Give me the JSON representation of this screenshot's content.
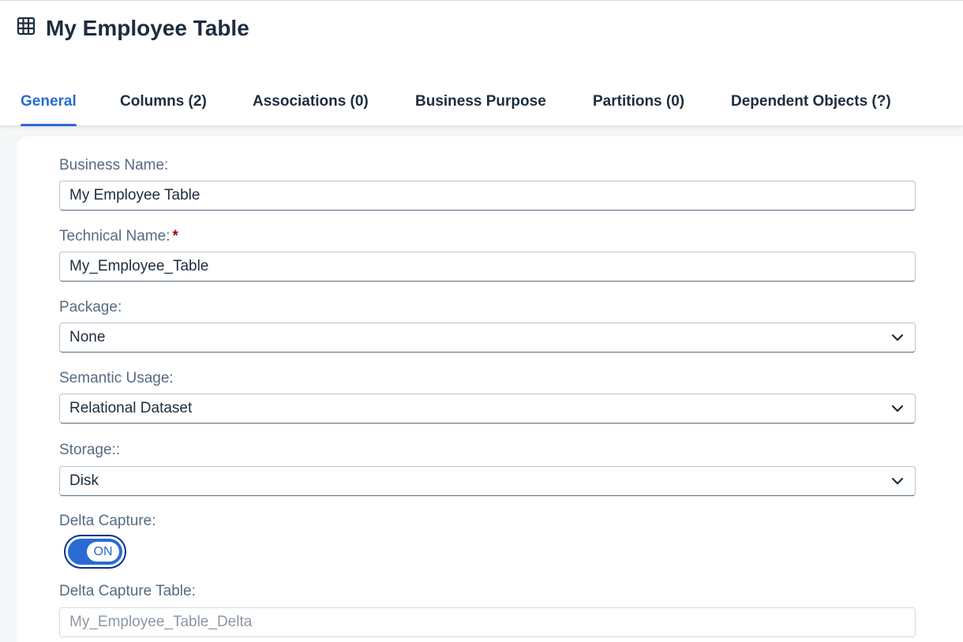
{
  "header": {
    "title": "My Employee Table",
    "icon": "table-grid-icon"
  },
  "tabs": [
    {
      "label": "General",
      "active": true
    },
    {
      "label": "Columns (2)",
      "active": false
    },
    {
      "label": "Associations (0)",
      "active": false
    },
    {
      "label": "Business Purpose",
      "active": false
    },
    {
      "label": "Partitions (0)",
      "active": false
    },
    {
      "label": "Dependent Objects (?)",
      "active": false
    }
  ],
  "form": {
    "business_name": {
      "label": "Business Name:",
      "value": "My Employee Table"
    },
    "technical_name": {
      "label": "Technical Name:",
      "required_mark": "*",
      "value": "My_Employee_Table"
    },
    "package": {
      "label": "Package:",
      "value": "None"
    },
    "semantic_usage": {
      "label": "Semantic Usage:",
      "value": "Relational Dataset"
    },
    "storage": {
      "label": "Storage::",
      "value": "Disk"
    },
    "delta_capture": {
      "label": "Delta Capture:",
      "toggle_text": "ON",
      "on": true
    },
    "delta_capture_table": {
      "label": "Delta Capture Table:",
      "value": "My_Employee_Table_Delta"
    }
  },
  "colors": {
    "accent": "#2a6bd3",
    "text": "#1d2d3e",
    "label": "#556b82",
    "required": "#aa0808"
  }
}
